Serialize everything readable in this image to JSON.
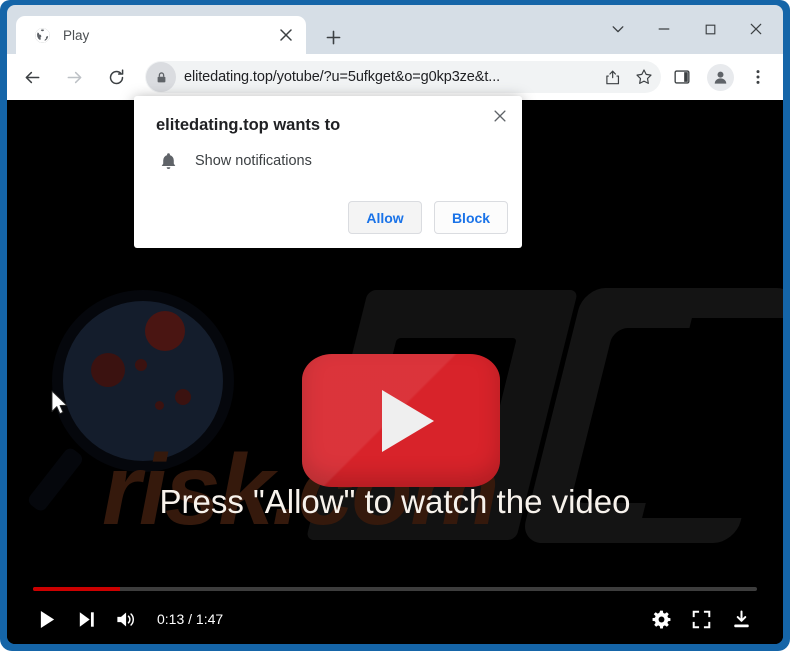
{
  "browser": {
    "tab": {
      "title": "Play",
      "favicon_icon": "globe-icon",
      "close_icon": "close-icon"
    },
    "new_tab_icon": "plus-icon",
    "window_controls": {
      "tab_search_icon": "chevron-down-icon",
      "minimize_icon": "minimize-icon",
      "maximize_icon": "maximize-icon",
      "close_icon": "close-icon"
    },
    "toolbar": {
      "back_icon": "arrow-left-icon",
      "forward_icon": "arrow-right-icon",
      "reload_icon": "reload-icon",
      "lock_icon": "lock-icon",
      "url": "elitedating.top/yotube/?u=5ufkget&o=g0kp3ze&t...",
      "share_icon": "share-icon",
      "bookmark_icon": "star-icon",
      "side_panel_icon": "side-panel-icon",
      "profile_icon": "person-icon",
      "menu_icon": "three-dot-menu-icon"
    }
  },
  "dialog": {
    "title": "elitedating.top wants to",
    "permission_icon": "bell-icon",
    "permission_label": "Show notifications",
    "allow_label": "Allow",
    "block_label": "Block",
    "close_icon": "close-icon"
  },
  "page": {
    "headline": "Press \"Allow\" to watch the video",
    "watermark_text": "risk.com",
    "play_badge_icon": "play-triangle-icon",
    "magnifier_icon": "magnifier-icon",
    "cursor_icon": "mouse-pointer-icon"
  },
  "player": {
    "progress_percent": "12",
    "progress_color": "#cc0000",
    "current_time": "0:13",
    "duration": "1:47",
    "time_display": "0:13 / 1:47",
    "play_icon": "play-icon",
    "next_icon": "next-track-icon",
    "volume_icon": "volume-icon",
    "settings_icon": "gear-icon",
    "fullscreen_icon": "fullscreen-icon",
    "download_icon": "download-icon"
  },
  "colors": {
    "window_frame": "#1565a8",
    "tab_strip": "#d6dee6",
    "accent_blue": "#1a73e8",
    "play_badge_red": "#d8232a",
    "progress_red": "#cc0000"
  }
}
